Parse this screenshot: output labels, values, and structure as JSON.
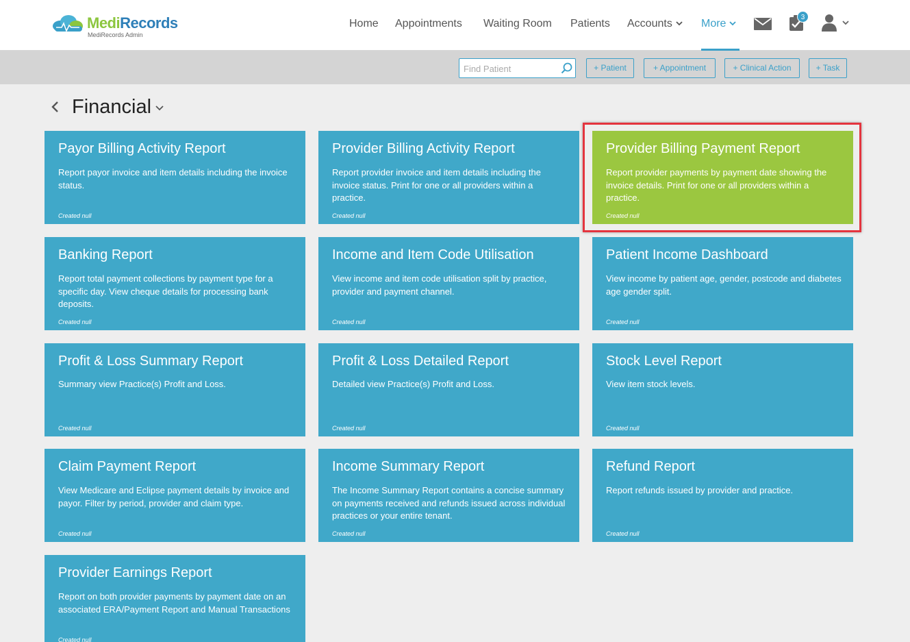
{
  "brand": {
    "name_part1": "Medi",
    "name_part2": "Records",
    "subtitle": "MediRecords Admin"
  },
  "nav": {
    "items": [
      {
        "label": "Home"
      },
      {
        "label": "Appointments"
      },
      {
        "label": "Waiting Room"
      },
      {
        "label": "Patients"
      },
      {
        "label": "Accounts"
      },
      {
        "label": "More"
      }
    ],
    "active": "More",
    "task_badge": "3"
  },
  "toolbar": {
    "search_placeholder": "Find Patient",
    "buttons": [
      {
        "label": "+ Patient"
      },
      {
        "label": "+ Appointment"
      },
      {
        "label": "+ Clinical Action"
      },
      {
        "label": "+ Task"
      }
    ]
  },
  "page": {
    "title": "Financial"
  },
  "reports": [
    {
      "title": "Payor Billing Activity Report",
      "description": "Report payor invoice and item details including the invoice status.",
      "footer": "Created null"
    },
    {
      "title": "Provider Billing Activity Report",
      "description": "Report provider invoice and item details including the invoice status. Print for one or all providers within a practice.",
      "footer": "Created null"
    },
    {
      "title": "Provider Billing Payment Report",
      "description": "Report provider payments by payment date showing the invoice details. Print for one or all providers within a practice.",
      "footer": "Created null"
    },
    {
      "title": "Banking Report",
      "description": "Report total payment collections by payment type for a specific day. View cheque details for processing bank deposits.",
      "footer": "Created null"
    },
    {
      "title": "Income and Item Code Utilisation",
      "description": "View income and item code utilisation split by practice, provider and payment channel.",
      "footer": "Created null"
    },
    {
      "title": "Patient Income Dashboard",
      "description": "View income by patient age, gender, postcode and diabetes age gender split.",
      "footer": "Created null"
    },
    {
      "title": "Profit & Loss Summary Report",
      "description": "Summary view Practice(s) Profit and Loss.",
      "footer": "Created null"
    },
    {
      "title": "Profit & Loss Detailed Report",
      "description": "Detailed view Practice(s) Profit and Loss.",
      "footer": "Created null"
    },
    {
      "title": "Stock Level Report",
      "description": "View item stock levels.",
      "footer": "Created null"
    },
    {
      "title": "Claim Payment Report",
      "description": "View Medicare and Eclipse payment details by invoice and payor. Filter by period, provider and claim type.",
      "footer": "Created null"
    },
    {
      "title": "Income Summary Report",
      "description": "The Income Summary Report contains a concise summary on payments received and refunds issued across individual practices or your entire tenant.",
      "footer": "Created null"
    },
    {
      "title": "Refund Report",
      "description": "Report refunds issued by provider and practice.",
      "footer": "Created null"
    },
    {
      "title": "Provider Earnings Report",
      "description": "Report on both provider payments by payment date on an associated ERA/Payment Report and Manual Transactions",
      "footer": "Created null"
    }
  ],
  "highlighted_report": "Provider Billing Payment Report",
  "colors": {
    "card": "#40a8c9",
    "card_highlight": "#9bc740",
    "accent": "#3aa0c9",
    "highlight_border": "#e4343e"
  }
}
